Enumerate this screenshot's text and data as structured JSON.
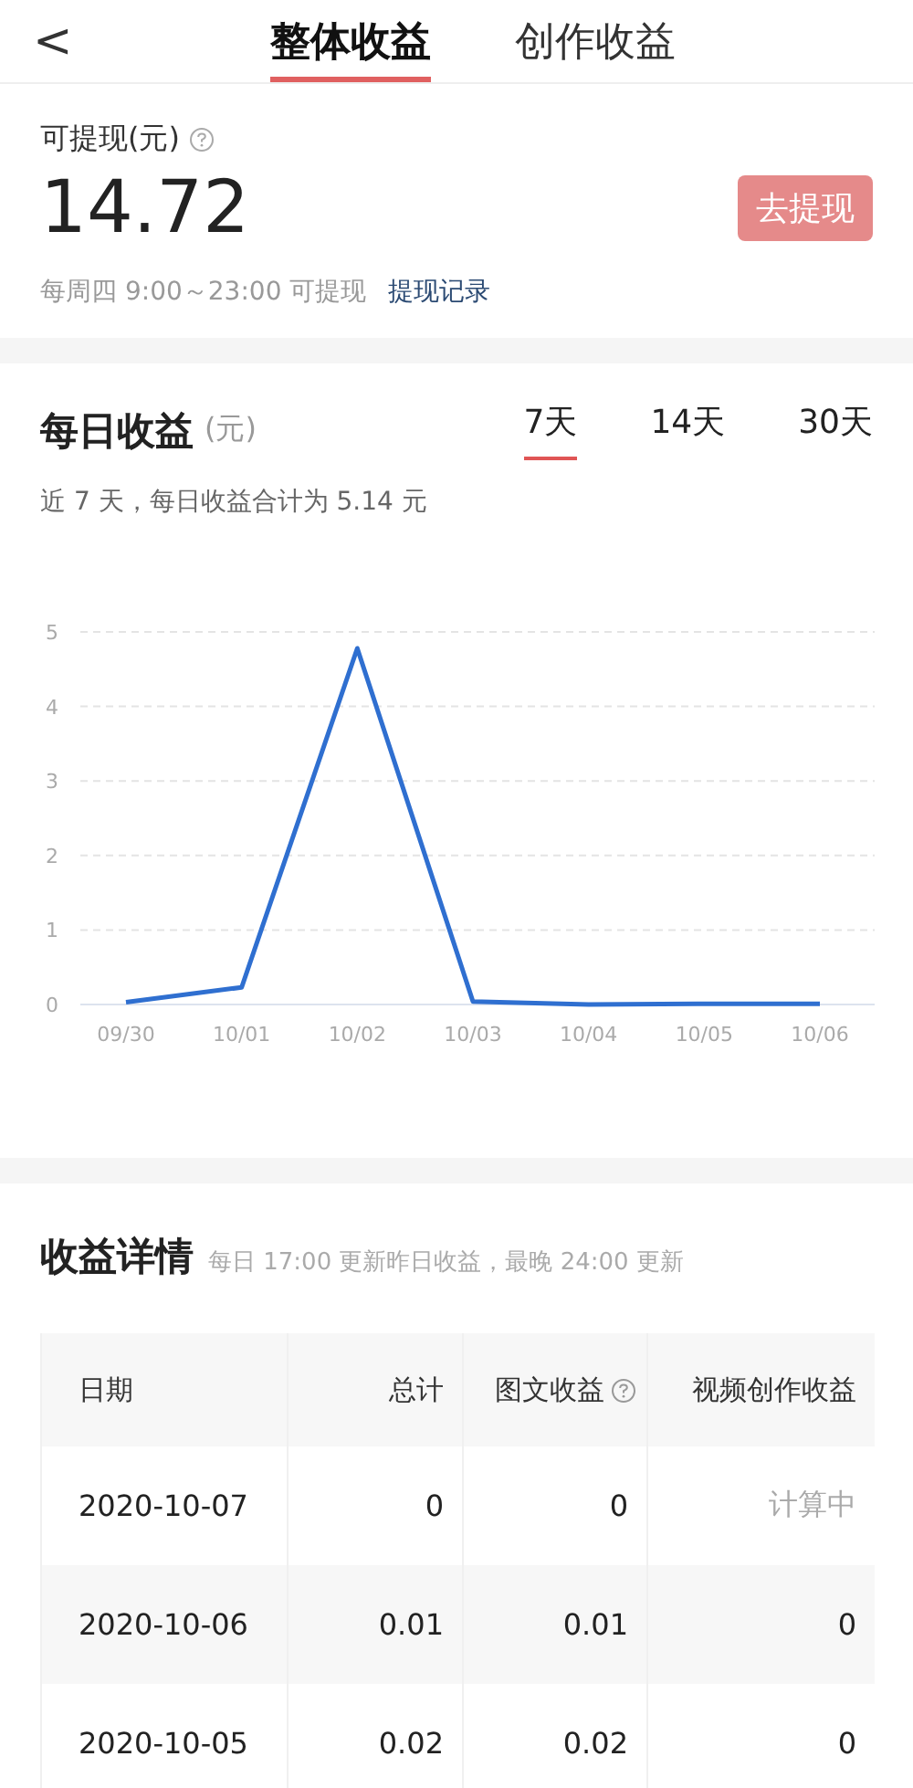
{
  "header": {
    "back": "<",
    "tabs": [
      {
        "label": "整体收益",
        "selected": true
      },
      {
        "label": "创作收益",
        "selected": false
      }
    ]
  },
  "balance": {
    "label": "可提现(元)",
    "amount": "14.72",
    "button": {
      "label": "去提现",
      "disabled": true
    },
    "note": "每周四 9:00～23:00 可提现",
    "link": "提现记录"
  },
  "daily": {
    "title": "每日收益",
    "unit": "(元)",
    "periods": [
      {
        "label": "7天",
        "selected": true
      },
      {
        "label": "14天",
        "selected": false
      },
      {
        "label": "30天",
        "selected": false
      }
    ],
    "summary": "近 7 天，每日收益合计为 5.14 元",
    "chart_data": {
      "type": "line",
      "categories": [
        "09/30",
        "10/01",
        "10/02",
        "10/03",
        "10/04",
        "10/05",
        "10/06"
      ],
      "series": [
        {
          "color": "#2f6fd0",
          "values": [
            0.03,
            0.23,
            4.78,
            0.04,
            0,
            0.01,
            0.01
          ]
        }
      ],
      "ylim": [
        0,
        5
      ],
      "grid": true,
      "yticks": [
        0,
        1,
        2,
        3,
        4,
        5
      ]
    }
  },
  "details": {
    "title": "收益详情",
    "note": "每日 17:00 更新昨日收益，最晚 24:00 更新",
    "columns": [
      {
        "label": "日期",
        "help": false
      },
      {
        "label": "总计",
        "help": false
      },
      {
        "label": "图文收益",
        "help": true
      },
      {
        "label": "视频创作收益",
        "help": false
      }
    ],
    "rows": [
      {
        "cells": [
          {
            "text": "2020-10-07",
            "pending": false
          },
          {
            "text": "0",
            "pending": false
          },
          {
            "text": "0",
            "pending": false
          },
          {
            "text": "计算中",
            "pending": true
          }
        ]
      },
      {
        "cells": [
          {
            "text": "2020-10-06",
            "pending": false
          },
          {
            "text": "0.01",
            "pending": false
          },
          {
            "text": "0.01",
            "pending": false
          },
          {
            "text": "0",
            "pending": false
          }
        ]
      },
      {
        "cells": [
          {
            "text": "2020-10-05",
            "pending": false
          },
          {
            "text": "0.02",
            "pending": false
          },
          {
            "text": "0.02",
            "pending": false
          },
          {
            "text": "0",
            "pending": false
          }
        ]
      }
    ]
  }
}
